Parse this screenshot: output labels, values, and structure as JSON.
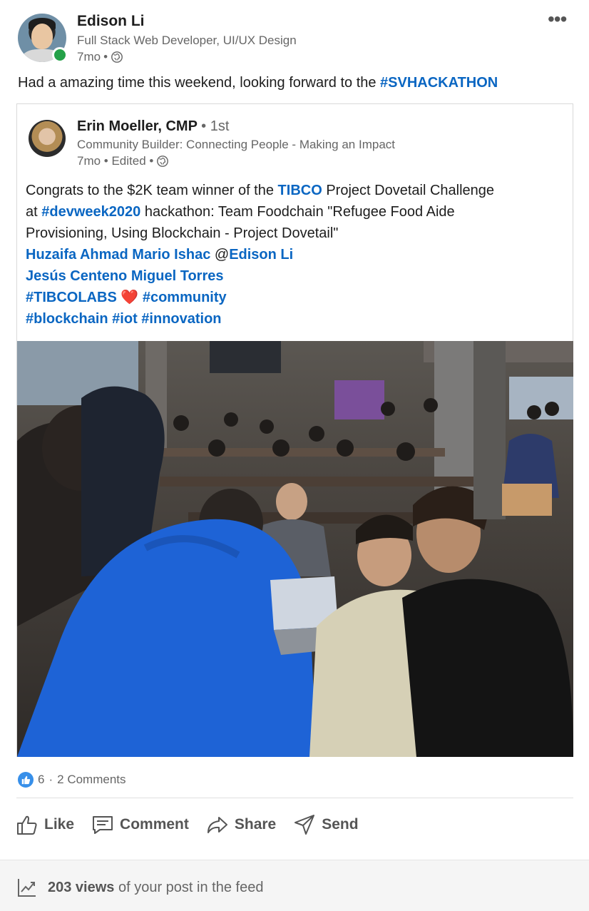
{
  "post": {
    "author": {
      "name": "Edison Li",
      "headline": "Full Stack Web Developer, UI/UX Design",
      "time": "7mo",
      "separator": "•"
    },
    "text": "Had a amazing time this weekend, looking forward to the ",
    "hashtag": "#SVHACKATHON"
  },
  "shared": {
    "author": {
      "name": "Erin Moeller, CMP",
      "degree": "• 1st",
      "headline": "Community Builder: Connecting People - Making an Impact",
      "meta": "7mo • Edited •"
    },
    "body": {
      "l1_a": "Congrats to the $2K team winner of the ",
      "l1_link": "TIBCO",
      "l1_b": " Project Dovetail Challenge",
      "l2_a": "at ",
      "l2_link": "#devweek2020",
      "l2_b": " hackathon: Team Foodchain \"Refugee Food Aide",
      "l3": "Provisioning, Using Blockchain - Project Dovetail\"",
      "l4_link1": "Huzaifa Ahmad Mario Ishac",
      "l4_at": " @",
      "l4_link2": "Edison Li",
      "l5_link": "Jesús Centeno Miguel Torres",
      "l6_link1": "#TIBCOLABS",
      "l6_emoji": "❤️",
      "l6_link2": "#community",
      "l7_link1": "#blockchain",
      "l7_link2": "#iot",
      "l7_link3": "#innovation"
    },
    "image_alt": "Hackathon venue with teams working at laptops"
  },
  "social": {
    "reaction_count": "6",
    "separator": "·",
    "comments": "2 Comments"
  },
  "actions": {
    "like": "Like",
    "comment": "Comment",
    "share": "Share",
    "send": "Send"
  },
  "footer": {
    "views_count": "203 views",
    "views_text": "of your post in the feed"
  }
}
